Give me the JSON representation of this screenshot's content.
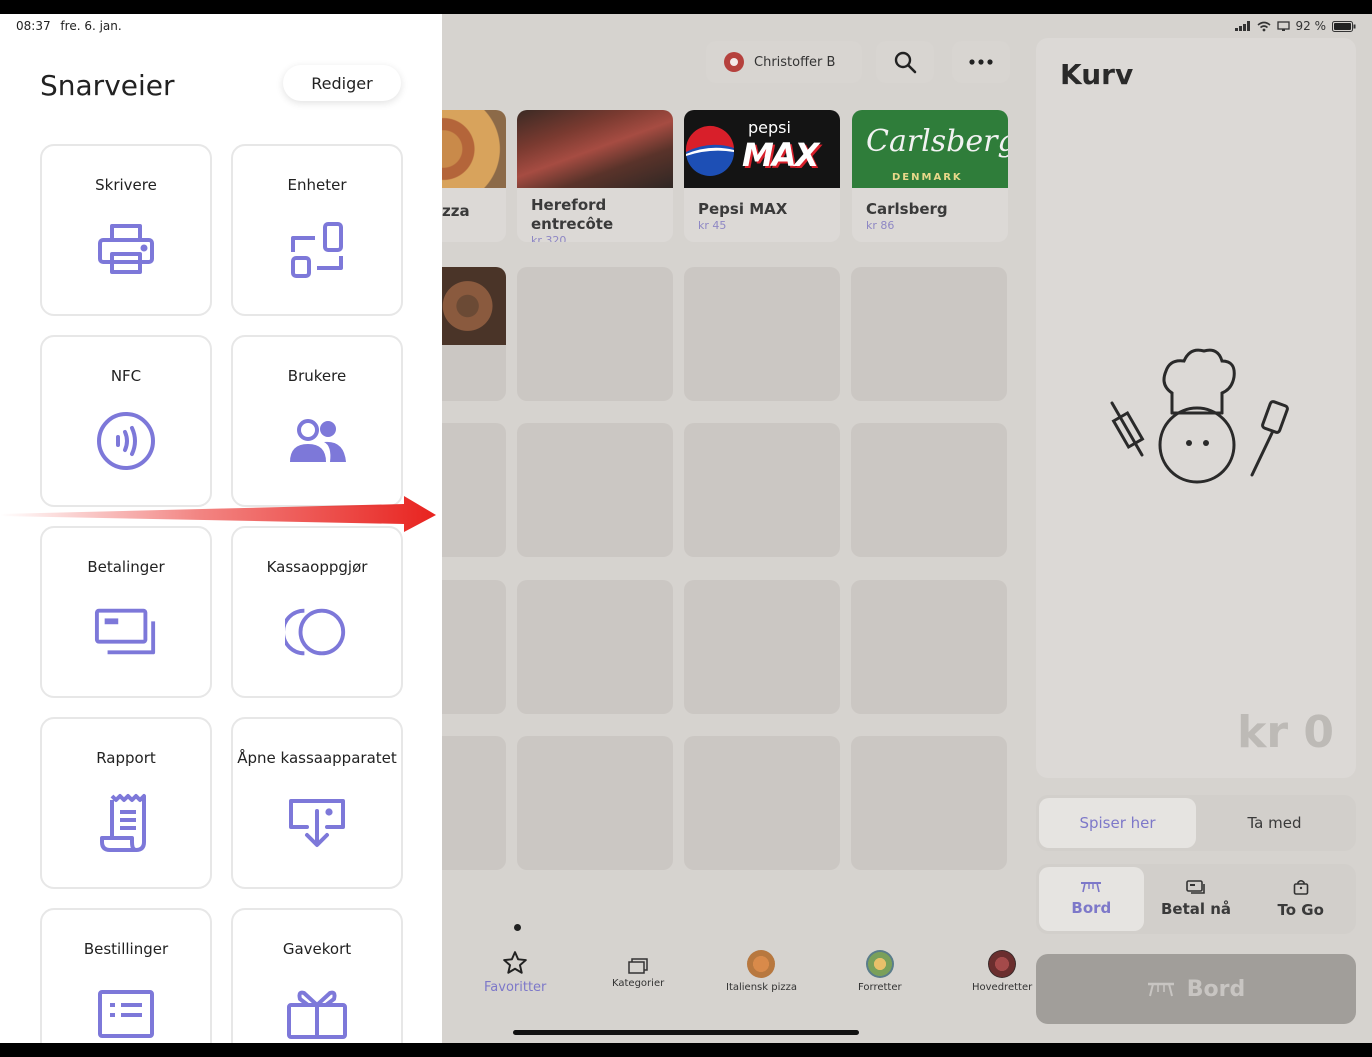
{
  "status_bar": {
    "time": "08:37",
    "date": "fre. 6. jan.",
    "battery": "92 %"
  },
  "top_bar": {
    "user_name": "Christoffer B"
  },
  "products": [
    {
      "name": "zza",
      "price": ""
    },
    {
      "name": "Hereford\nentrecôte",
      "price": "kr 320"
    },
    {
      "name": "Pepsi MAX",
      "price": "kr 45",
      "logo_top": "pepsi",
      "logo_main": "MAX"
    },
    {
      "name": "Carlsberg",
      "price": "kr 86",
      "logo_main": "Carlsberg",
      "logo_sub": "DENMARK"
    }
  ],
  "cart": {
    "title": "Kurv",
    "total": "kr 0",
    "dine_options": [
      {
        "label": "Spiser her",
        "active": true
      },
      {
        "label": "Ta med",
        "active": false
      }
    ],
    "order_options": [
      {
        "label": "Bord",
        "icon": "table-icon",
        "active": true
      },
      {
        "label": "Betal nå",
        "icon": "card-icon",
        "active": false
      },
      {
        "label": "To Go",
        "icon": "bag-icon",
        "active": false
      }
    ],
    "action_label": "Bord"
  },
  "bottom_nav": [
    {
      "label": "Favoritter",
      "icon": "star-icon",
      "active": true
    },
    {
      "label": "Kategorier",
      "icon": "folder-icon",
      "active": false
    },
    {
      "label": "Italiensk pizza",
      "icon": "pizza-thumb",
      "active": false
    },
    {
      "label": "Forretter",
      "icon": "starter-thumb",
      "active": false
    },
    {
      "label": "Hovedretter",
      "icon": "main-thumb",
      "active": false
    }
  ],
  "drawer": {
    "title": "Snarveier",
    "edit_label": "Rediger",
    "shortcuts": [
      {
        "label": "Skrivere",
        "icon": "printer-icon"
      },
      {
        "label": "Enheter",
        "icon": "devices-icon"
      },
      {
        "label": "NFC",
        "icon": "nfc-icon"
      },
      {
        "label": "Brukere",
        "icon": "users-icon"
      },
      {
        "label": "Betalinger",
        "icon": "payments-icon"
      },
      {
        "label": "Kassaoppgjør",
        "icon": "settlement-icon"
      },
      {
        "label": "Rapport",
        "icon": "report-icon"
      },
      {
        "label": "Åpne kassaapparatet",
        "icon": "cash-drawer-icon"
      },
      {
        "label": "Bestillinger",
        "icon": "orders-icon"
      },
      {
        "label": "Gavekort",
        "icon": "giftcard-icon"
      }
    ]
  },
  "colors": {
    "accent": "#7d78c9",
    "arrow": "#e8231f"
  }
}
